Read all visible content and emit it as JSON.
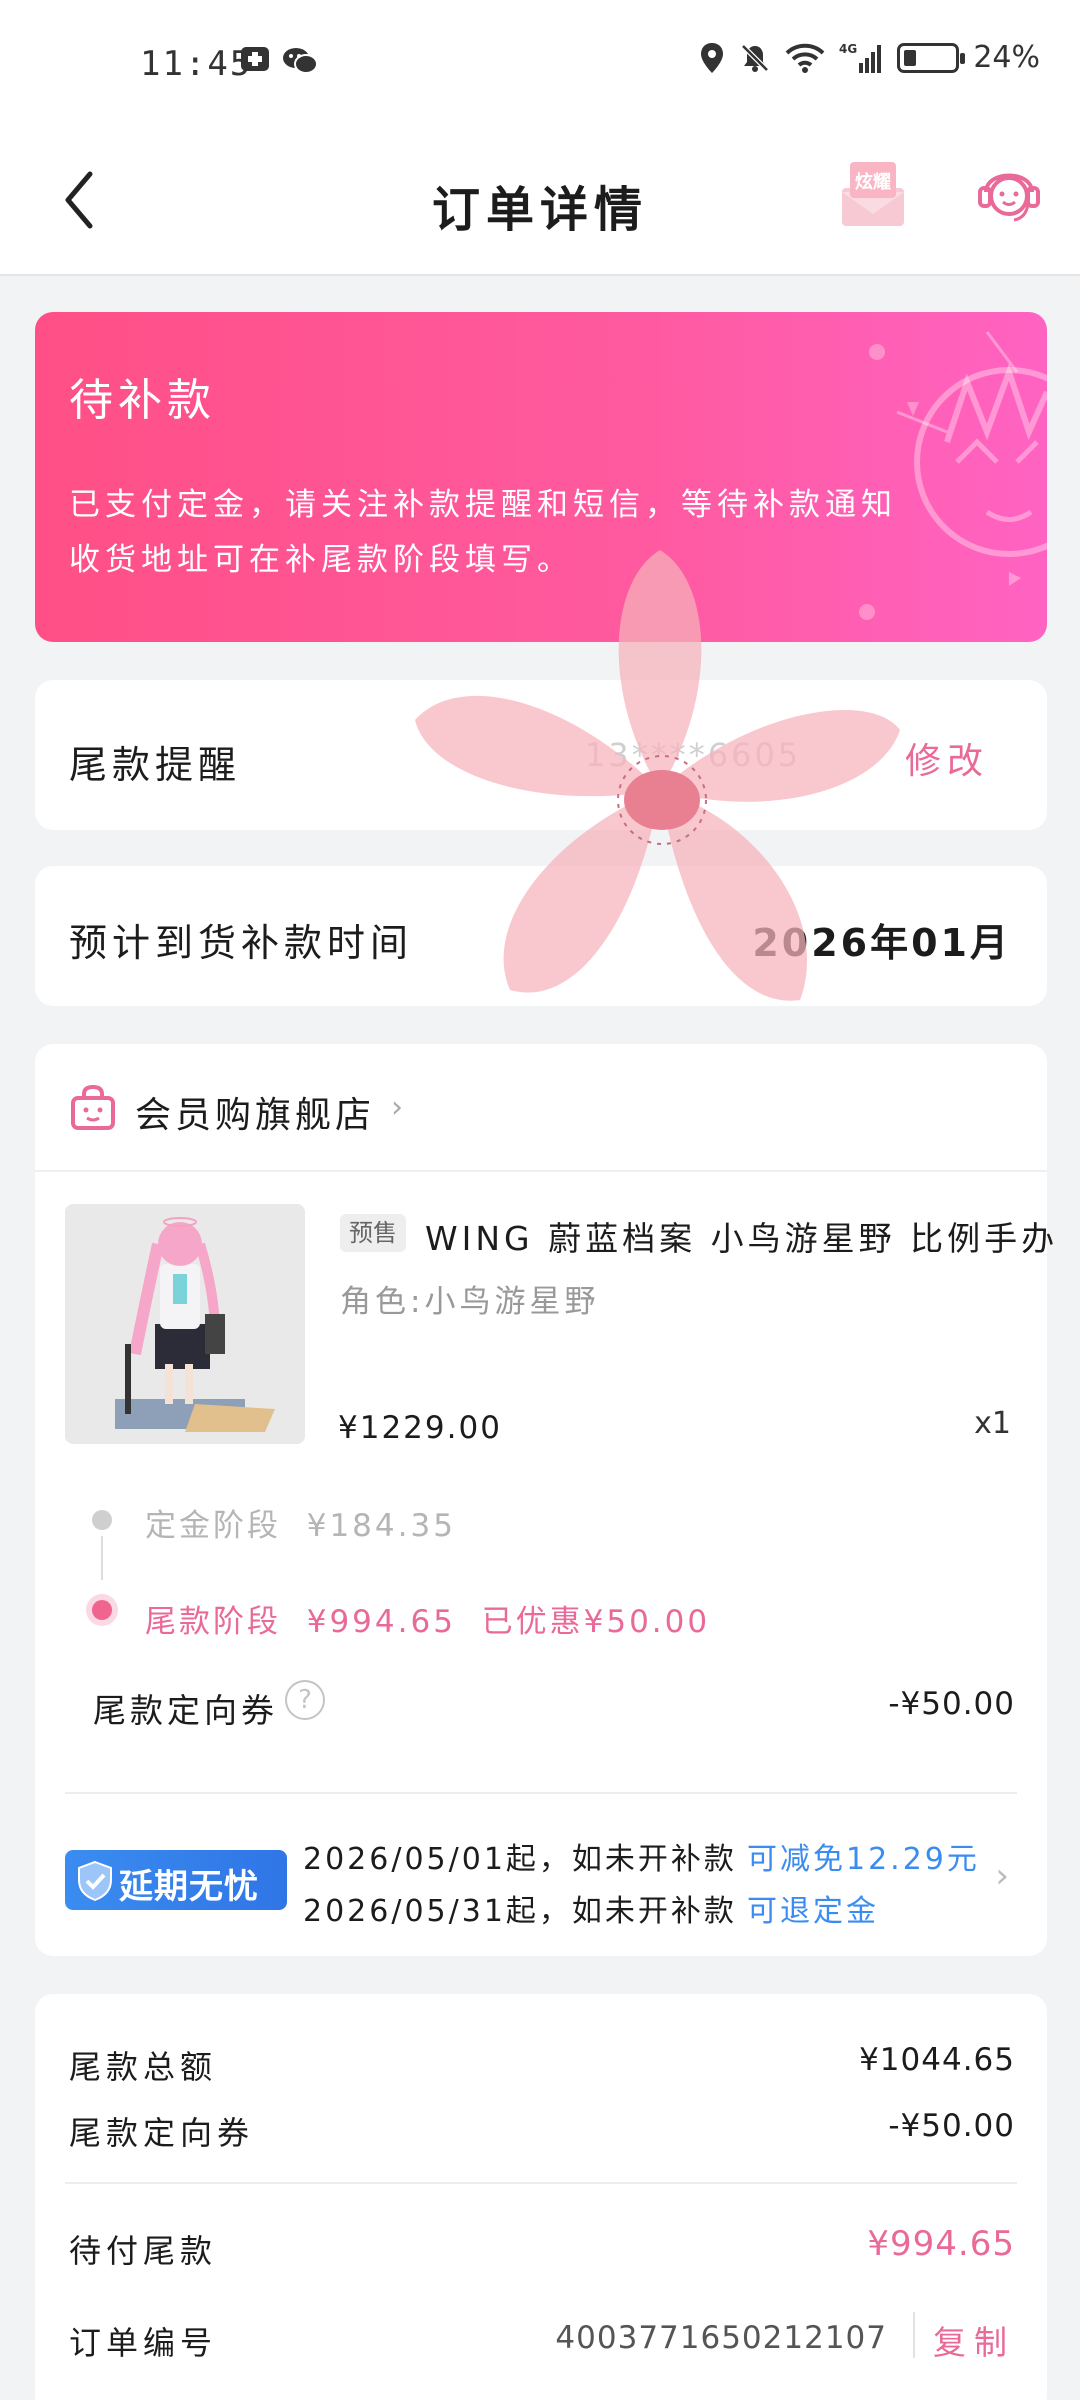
{
  "status_bar": {
    "time": "11:45",
    "battery": "24%",
    "battery_level": 0.24,
    "network": "4G"
  },
  "header": {
    "title": "订单详情",
    "flaunt_label": "炫耀"
  },
  "banner": {
    "title": "待补款",
    "line1": "已支付定金，请关注补款提醒和短信，等待补款通知",
    "line2": "收货地址可在补尾款阶段填写。"
  },
  "reminder": {
    "label": "尾款提醒",
    "phone_masked": "13****6605",
    "action": "修改"
  },
  "arrival": {
    "label": "预计到货补款时间",
    "value": "2026年01月"
  },
  "shop": {
    "name": "会员购旗舰店"
  },
  "product": {
    "tag": "预售",
    "title": "WING 蔚蓝档案 小鸟游星野 比例手办",
    "spec": "角色:小鸟游星野",
    "price": "¥1229.00",
    "qty": "x1"
  },
  "stages": {
    "deposit_label": "定金阶段",
    "deposit_amount": "¥184.35",
    "final_label": "尾款阶段",
    "final_amount": "¥994.65",
    "final_discount": "已优惠¥50.00"
  },
  "coupon": {
    "label": "尾款定向券",
    "value": "-¥50.00"
  },
  "delay": {
    "badge": "延期无忧",
    "line1_text": "2026/05/01起，如未开补款",
    "line1_link": "可减免12.29元",
    "line2_text": "2026/05/31起，如未开补款",
    "line2_link": "可退定金"
  },
  "summary": {
    "total_label": "尾款总额",
    "total_value": "¥1044.65",
    "coupon_label": "尾款定向券",
    "coupon_value": "-¥50.00",
    "due_label": "待付尾款",
    "due_value": "¥994.65",
    "order_label": "订单编号",
    "order_value": "4003771650212107",
    "copy_label": "复制"
  },
  "colors": {
    "accent_pink": "#e96a98",
    "banner_start": "#ff4f86",
    "banner_end": "#ff63c2",
    "link_blue": "#3b8cf0"
  }
}
